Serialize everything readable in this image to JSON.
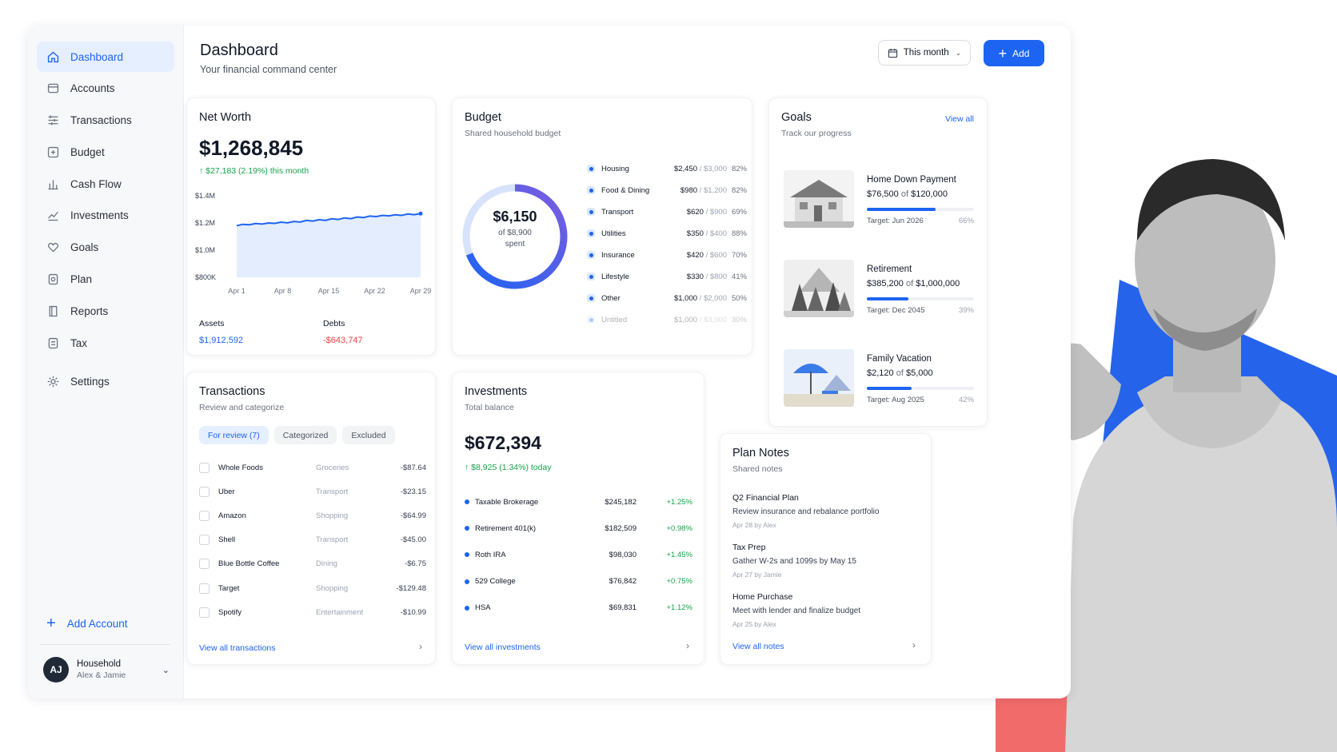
{
  "colors": {
    "accent": "#1d64f2",
    "positive": "#16a34a",
    "negative": "#ef4444"
  },
  "sidebar": {
    "items": [
      {
        "label": "Dashboard",
        "icon": "home-icon",
        "active": true
      },
      {
        "label": "Accounts",
        "icon": "wallet-icon"
      },
      {
        "label": "Transactions",
        "icon": "list-icon"
      },
      {
        "label": "Budget",
        "icon": "budget-icon"
      },
      {
        "label": "Cash Flow",
        "icon": "cash-flow-icon"
      },
      {
        "label": "Investments",
        "icon": "investments-icon"
      },
      {
        "label": "Goals",
        "icon": "heart-icon"
      },
      {
        "label": "Plan",
        "icon": "plan-icon"
      },
      {
        "label": "Reports",
        "icon": "reports-icon"
      },
      {
        "label": "Tax",
        "icon": "tax-icon"
      }
    ],
    "settings_label": "Settings",
    "add_account_label": "Add Account",
    "household": {
      "initials": "AJ",
      "name": "Household",
      "members": "Alex & Jamie"
    }
  },
  "header": {
    "title": "Dashboard",
    "subtitle": "Your financial command center",
    "period_label": "This month",
    "add_label": "Add"
  },
  "net_worth": {
    "title": "Net Worth",
    "value": "$1,268,845",
    "change": "$27,183 (2.19%) this month",
    "chart_data": {
      "type": "area",
      "y_ticks": [
        "$1.4M",
        "$1.2M",
        "$1.0M",
        "$800K"
      ],
      "x_ticks": [
        "Apr 1",
        "Apr 8",
        "Apr 15",
        "Apr 22",
        "Apr 29"
      ],
      "ylim": [
        800000,
        1400000
      ],
      "values": [
        1180000,
        1190000,
        1187000,
        1196000,
        1192000,
        1200000,
        1197000,
        1206000,
        1201000,
        1211000,
        1207000,
        1219000,
        1214000,
        1224000,
        1219000,
        1231000,
        1226000,
        1237000,
        1232000,
        1244000,
        1240000,
        1251000,
        1247000,
        1256000,
        1252000,
        1260000,
        1256000,
        1266000,
        1261000,
        1268845
      ]
    },
    "assets_label": "Assets",
    "assets_value": "$1,912,592",
    "debts_label": "Debts",
    "debts_value": "-$643,747"
  },
  "budget": {
    "title": "Budget",
    "subtitle": "Shared household budget",
    "spent": "$6,150",
    "of_label": "of $8,900",
    "spent_label": "spent",
    "spent_fraction": 0.691,
    "rows": [
      {
        "name": "Housing",
        "spent": "$2,450",
        "total": "$3,000",
        "pct": "82%"
      },
      {
        "name": "Food & Dining",
        "spent": "$980",
        "total": "$1,200",
        "pct": "82%"
      },
      {
        "name": "Transport",
        "spent": "$620",
        "total": "$900",
        "pct": "69%"
      },
      {
        "name": "Utilities",
        "spent": "$350",
        "total": "$400",
        "pct": "88%"
      },
      {
        "name": "Insurance",
        "spent": "$420",
        "total": "$600",
        "pct": "70%"
      },
      {
        "name": "Lifestyle",
        "spent": "$330",
        "total": "$800",
        "pct": "41%"
      },
      {
        "name": "Other",
        "spent": "$1,000",
        "total": "$2,000",
        "pct": "50%"
      },
      {
        "name": "Untitled",
        "spent": "$1,000",
        "total": "$3,000",
        "pct": "30%"
      }
    ]
  },
  "goals": {
    "title": "Goals",
    "subtitle": "Track our progress",
    "view_all": "View all",
    "items": [
      {
        "name": "Home Down Payment",
        "current": "$76,500",
        "of": "of",
        "target_amount": "$120,000",
        "target": "Target: Jun 2026",
        "pct": "66%",
        "progress": 0.64,
        "image": "house-icon"
      },
      {
        "name": "Retirement",
        "current": "$385,200",
        "of": "of",
        "target_amount": "$1,000,000",
        "target": "Target: Dec 2045",
        "pct": "39%",
        "progress": 0.39,
        "image": "trees-icon"
      },
      {
        "name": "Family Vacation",
        "current": "$2,120",
        "of": "of",
        "target_amount": "$5,000",
        "target": "Target: Aug 2025",
        "pct": "42%",
        "progress": 0.42,
        "image": "beach-umbrella-icon"
      }
    ]
  },
  "transactions": {
    "title": "Transactions",
    "subtitle": "Review and categorize",
    "tabs": [
      "For review (7)",
      "Categorized",
      "Excluded"
    ],
    "rows": [
      {
        "merchant": "Whole Foods",
        "category": "Groceries",
        "amount": "-$87.64"
      },
      {
        "merchant": "Uber",
        "category": "Transport",
        "amount": "-$23.15"
      },
      {
        "merchant": "Amazon",
        "category": "Shopping",
        "amount": "-$64.99"
      },
      {
        "merchant": "Shell",
        "category": "Transport",
        "amount": "-$45.00"
      },
      {
        "merchant": "Blue Bottle Coffee",
        "category": "Dining",
        "amount": "-$6.75"
      },
      {
        "merchant": "Target",
        "category": "Shopping",
        "amount": "-$129.48"
      },
      {
        "merchant": "Spotify",
        "category": "Entertainment",
        "amount": "-$10.99"
      }
    ],
    "view_all": "View all transactions"
  },
  "investments": {
    "title": "Investments",
    "subtitle": "Total balance",
    "value": "$672,394",
    "change": "$8,925 (1.34%) today",
    "rows": [
      {
        "name": "Taxable Brokerage",
        "balance": "$245,182",
        "change": "+1.25%"
      },
      {
        "name": "Retirement 401(k)",
        "balance": "$182,509",
        "change": "+0.98%"
      },
      {
        "name": "Roth IRA",
        "balance": "$98,030",
        "change": "+1.45%"
      },
      {
        "name": "529 College",
        "balance": "$76,842",
        "change": "+0.75%"
      },
      {
        "name": "HSA",
        "balance": "$69,831",
        "change": "+1.12%"
      }
    ],
    "view_all": "View all investments"
  },
  "plan_notes": {
    "title": "Plan Notes",
    "subtitle": "Shared notes",
    "notes": [
      {
        "title": "Q2 Financial Plan",
        "body": "Review insurance and rebalance portfolio",
        "meta": "Apr 28 by Alex"
      },
      {
        "title": "Tax Prep",
        "body": "Gather W-2s and 1099s by May 15",
        "meta": "Apr 27 by Jamie"
      },
      {
        "title": "Home Purchase",
        "body": "Meet with lender and finalize budget",
        "meta": "Apr 25 by Alex"
      }
    ],
    "view_all": "View all notes"
  }
}
